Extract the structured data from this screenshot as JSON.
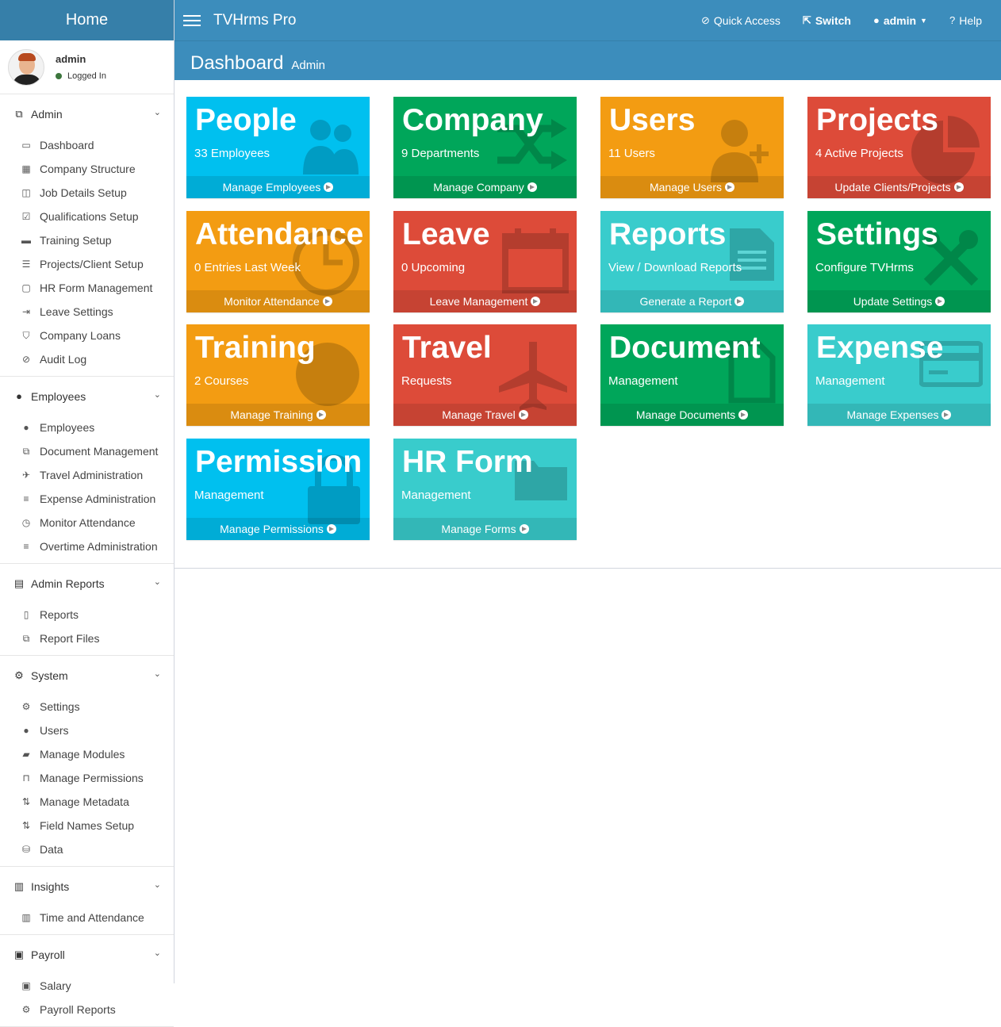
{
  "sidebar": {
    "brand": "Home",
    "user": {
      "name": "admin",
      "status": "Logged In"
    },
    "sections": [
      {
        "title": "Admin",
        "icon": "cubes-icon",
        "items": [
          {
            "label": "Dashboard",
            "icon": "desktop-icon"
          },
          {
            "label": "Company Structure",
            "icon": "building-icon"
          },
          {
            "label": "Job Details Setup",
            "icon": "columns-icon"
          },
          {
            "label": "Qualifications Setup",
            "icon": "check-square-icon"
          },
          {
            "label": "Training Setup",
            "icon": "briefcase-icon"
          },
          {
            "label": "Projects/Client Setup",
            "icon": "list-alt-icon"
          },
          {
            "label": "HR Form Management",
            "icon": "folder-icon"
          },
          {
            "label": "Leave Settings",
            "icon": "sign-out-icon"
          },
          {
            "label": "Company Loans",
            "icon": "shield-icon"
          },
          {
            "label": "Audit Log",
            "icon": "compass-icon"
          }
        ]
      },
      {
        "title": "Employees",
        "icon": "users-icon",
        "items": [
          {
            "label": "Employees",
            "icon": "users-icon"
          },
          {
            "label": "Document Management",
            "icon": "files-icon"
          },
          {
            "label": "Travel Administration",
            "icon": "plane-icon"
          },
          {
            "label": "Expense Administration",
            "icon": "bars-icon"
          },
          {
            "label": "Monitor Attendance",
            "icon": "clock-icon"
          },
          {
            "label": "Overtime Administration",
            "icon": "align-center-icon"
          }
        ]
      },
      {
        "title": "Admin Reports",
        "icon": "file-text-icon",
        "items": [
          {
            "label": "Reports",
            "icon": "file-icon"
          },
          {
            "label": "Report Files",
            "icon": "files-icon"
          }
        ]
      },
      {
        "title": "System",
        "icon": "cogs-icon",
        "items": [
          {
            "label": "Settings",
            "icon": "cogs-icon"
          },
          {
            "label": "Users",
            "icon": "user-icon"
          },
          {
            "label": "Manage Modules",
            "icon": "folder-open-icon"
          },
          {
            "label": "Manage Permissions",
            "icon": "unlock-icon"
          },
          {
            "label": "Manage Metadata",
            "icon": "sort-alpha-icon"
          },
          {
            "label": "Field Names Setup",
            "icon": "sort-alpha-icon"
          },
          {
            "label": "Data",
            "icon": "database-icon"
          }
        ]
      },
      {
        "title": "Insights",
        "icon": "bar-chart-icon",
        "items": [
          {
            "label": "Time and Attendance",
            "icon": "bar-chart-icon"
          }
        ]
      },
      {
        "title": "Payroll",
        "icon": "money-icon",
        "items": [
          {
            "label": "Salary",
            "icon": "money-icon"
          },
          {
            "label": "Payroll Reports",
            "icon": "cogs-icon"
          }
        ]
      }
    ]
  },
  "topbar": {
    "app_title": "TVHrms Pro",
    "quick_access": "Quick Access",
    "switch": "Switch",
    "user": "admin",
    "help": "Help"
  },
  "header": {
    "title": "Dashboard",
    "subtitle": "Admin"
  },
  "tiles": [
    {
      "title": "People",
      "sub": "33 Employees",
      "link": "Manage Employees",
      "color": "#00c0ef",
      "icon": "users-icon"
    },
    {
      "title": "Company",
      "sub": "9 Departments",
      "link": "Manage Company",
      "color": "#00a65a",
      "icon": "random-icon"
    },
    {
      "title": "Users",
      "sub": "11 Users",
      "link": "Manage Users",
      "color": "#f39c12",
      "icon": "user-plus-icon"
    },
    {
      "title": "Projects",
      "sub": "4 Active Projects",
      "link": "Update Clients/Projects",
      "color": "#dd4b39",
      "icon": "pie-chart-icon"
    },
    {
      "title": "Attendance",
      "sub": "0 Entries Last Week",
      "link": "Monitor Attendance",
      "color": "#f39c12",
      "icon": "clock-icon"
    },
    {
      "title": "Leave",
      "sub": "0 Upcoming",
      "link": "Leave Management",
      "color": "#dd4b39",
      "icon": "calendar-icon"
    },
    {
      "title": "Reports",
      "sub": "View / Download Reports",
      "link": "Generate a Report",
      "color": "#39cccc",
      "icon": "file-text-icon"
    },
    {
      "title": "Settings",
      "sub": "Configure TVHrms",
      "link": "Update Settings",
      "color": "#00a65a",
      "icon": "wrench-icon"
    },
    {
      "title": "Training",
      "sub": "2 Courses",
      "link": "Manage Training",
      "color": "#f39c12",
      "icon": "radiation-icon"
    },
    {
      "title": "Travel",
      "sub": "Requests",
      "link": "Manage Travel",
      "color": "#dd4b39",
      "icon": "plane-icon"
    },
    {
      "title": "Document",
      "sub": "Management",
      "link": "Manage Documents",
      "color": "#00a65a",
      "icon": "file-icon"
    },
    {
      "title": "Expense",
      "sub": "Management",
      "link": "Manage Expenses",
      "color": "#39cccc",
      "icon": "credit-card-icon"
    },
    {
      "title": "Permission",
      "sub": "Management",
      "link": "Manage Permissions",
      "color": "#00c0ef",
      "icon": "lock-icon"
    },
    {
      "title": "HR Form",
      "sub": "Management",
      "link": "Manage Forms",
      "color": "#39cccc",
      "icon": "folder-icon"
    }
  ]
}
